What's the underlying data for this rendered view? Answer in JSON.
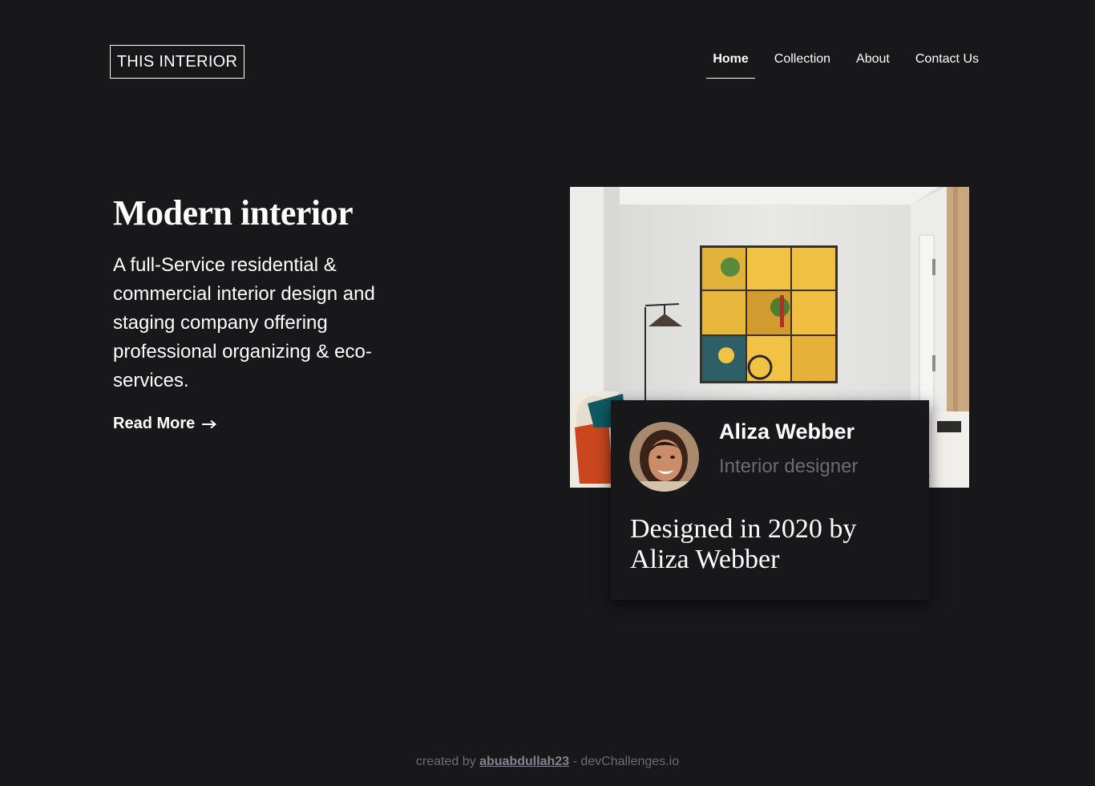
{
  "header": {
    "logo": "THIS INTERIOR",
    "nav": [
      {
        "label": "Home",
        "active": true
      },
      {
        "label": "Collection",
        "active": false
      },
      {
        "label": "About",
        "active": false
      },
      {
        "label": "Contact Us",
        "active": false
      }
    ]
  },
  "hero": {
    "title": "Modern interior",
    "description": "A full-Service residential & commercial interior design and staging company offering professional organizing & eco-services.",
    "read_more": "Read More",
    "read_more_icon": "arrow-right-icon"
  },
  "card": {
    "name": "Aliza Webber",
    "role": "Interior designer",
    "caption": "Designed in 2020 by Aliza Webber"
  },
  "footer": {
    "prefix": "created by",
    "author": "abuabdullah23",
    "suffix": "- devChallenges.io"
  },
  "colors": {
    "background": "#18181b",
    "text": "#ffffff",
    "muted": "#6b6b73"
  }
}
